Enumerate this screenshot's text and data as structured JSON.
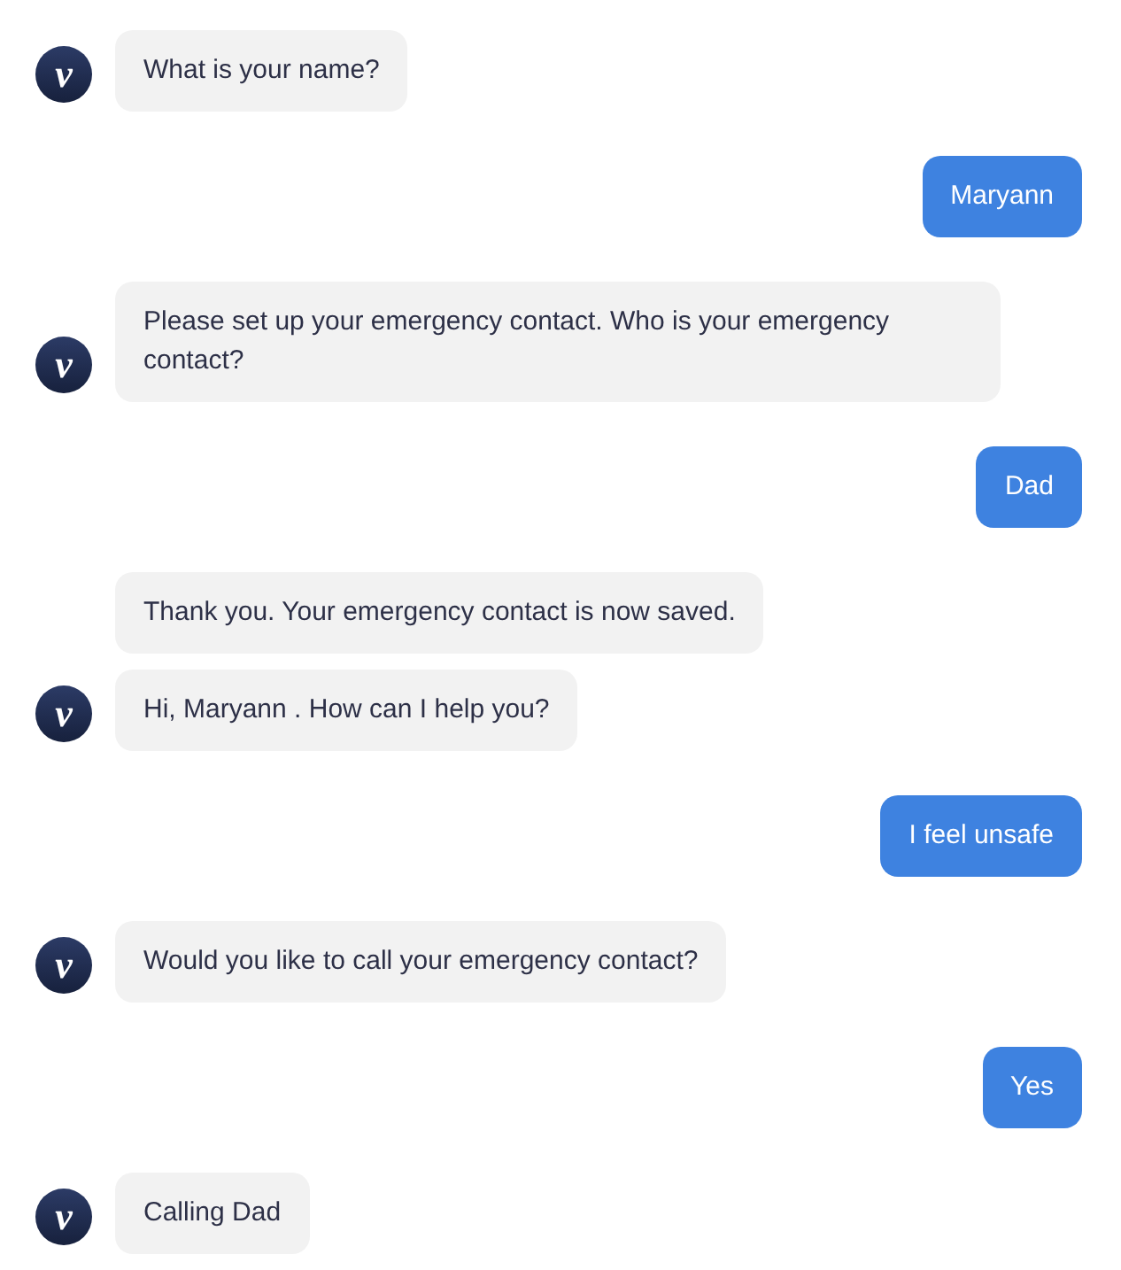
{
  "messages": [
    {
      "kind": "bot",
      "text": "What is your name?",
      "avatar": "v"
    },
    {
      "kind": "user",
      "text": "Maryann"
    },
    {
      "kind": "bot",
      "text": "Please set up your emergency contact. Who is your emergency contact?",
      "avatar": "v"
    },
    {
      "kind": "user",
      "text": "Dad"
    },
    {
      "kind": "bot",
      "text": "Thank you. Your emergency contact is now saved."
    },
    {
      "kind": "bot",
      "text": "Hi, Maryann . How can I help you?",
      "avatar": "v"
    },
    {
      "kind": "user",
      "text": "I feel unsafe"
    },
    {
      "kind": "bot",
      "text": "Would you like to call your emergency contact?",
      "avatar": "v"
    },
    {
      "kind": "user",
      "text": "Yes"
    },
    {
      "kind": "bot",
      "text": "Calling Dad",
      "avatar": "v"
    }
  ]
}
